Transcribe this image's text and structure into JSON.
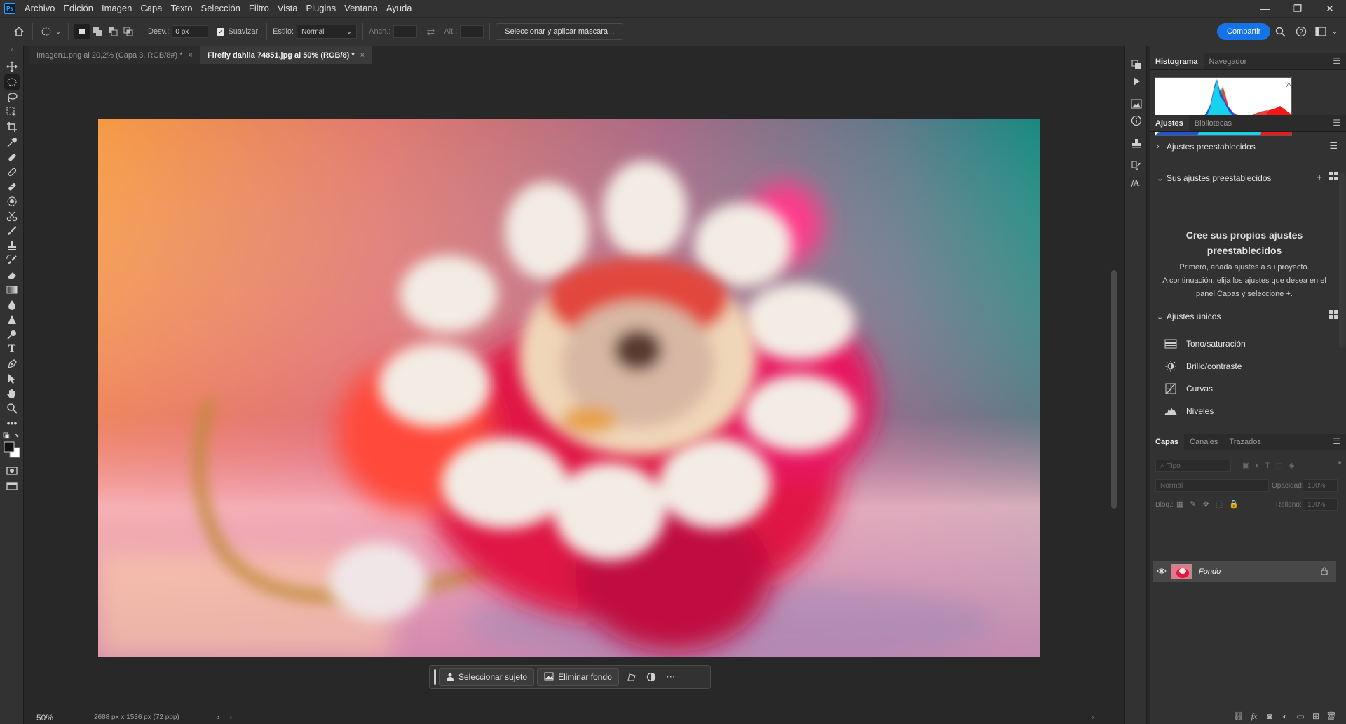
{
  "app": {
    "logo": "Ps"
  },
  "menu": [
    "Archivo",
    "Edición",
    "Imagen",
    "Capa",
    "Texto",
    "Selección",
    "Filtro",
    "Vista",
    "Plugins",
    "Ventana",
    "Ayuda"
  ],
  "window_controls": {
    "minimize": "—",
    "restore": "❐",
    "close": "✕"
  },
  "options": {
    "feather_label": "Desv.:",
    "feather_value": "0 px",
    "antialias_label": "Suavizar",
    "style_label": "Estilo:",
    "style_value": "Normal",
    "width_label": "Anch.:",
    "height_label": "Alt.:",
    "select_mask_button": "Seleccionar y aplicar máscara...",
    "share_button": "Compartir"
  },
  "tabs": [
    {
      "label": "Imagen1.png al 20,2% (Capa 3, RGB/8#) *",
      "close": "×"
    },
    {
      "label": "Firefly dahlia 74851.jpg al 50% (RGB/8) *",
      "close": "×"
    }
  ],
  "context_bar": {
    "select_subject": "Seleccionar sujeto",
    "remove_background": "Eliminar fondo",
    "more": "⋯"
  },
  "status": {
    "zoom": "50%",
    "doc_info": "2688 px x 1536 px (72 ppp)"
  },
  "panels": {
    "top_tabs": [
      "Histograma",
      "Navegador"
    ],
    "adj_tabs": [
      "Ajustes",
      "Bibliotecas"
    ],
    "presets_section": "Ajustes preestablecidos",
    "your_presets_section": "Sus ajustes preestablecidos",
    "your_presets_title": "Cree sus propios ajustes preestablecidos",
    "your_presets_body1": "Primero, añada ajustes a su proyecto.",
    "your_presets_body2": "A continuación, elija los ajustes que desea en el panel Capas y seleccione",
    "single_adjustments": "Ajustes únicos",
    "adjustments": [
      "Tono/saturación",
      "Brillo/contraste",
      "Curvas",
      "Niveles"
    ],
    "layers_tabs": [
      "Capas",
      "Canales",
      "Trazados"
    ],
    "layer_search_placeholder": "Tipo",
    "blend_mode": "Normal",
    "opacity_label": "Opacidad:",
    "opacity_value": "100%",
    "lock_label": "Bloq.:",
    "fill_label": "Relleno:",
    "fill_value": "100%",
    "layer_name": "Fondo"
  },
  "colors": {
    "accent": "#1473e6",
    "panel": "#323232",
    "canvas": "#282828"
  }
}
